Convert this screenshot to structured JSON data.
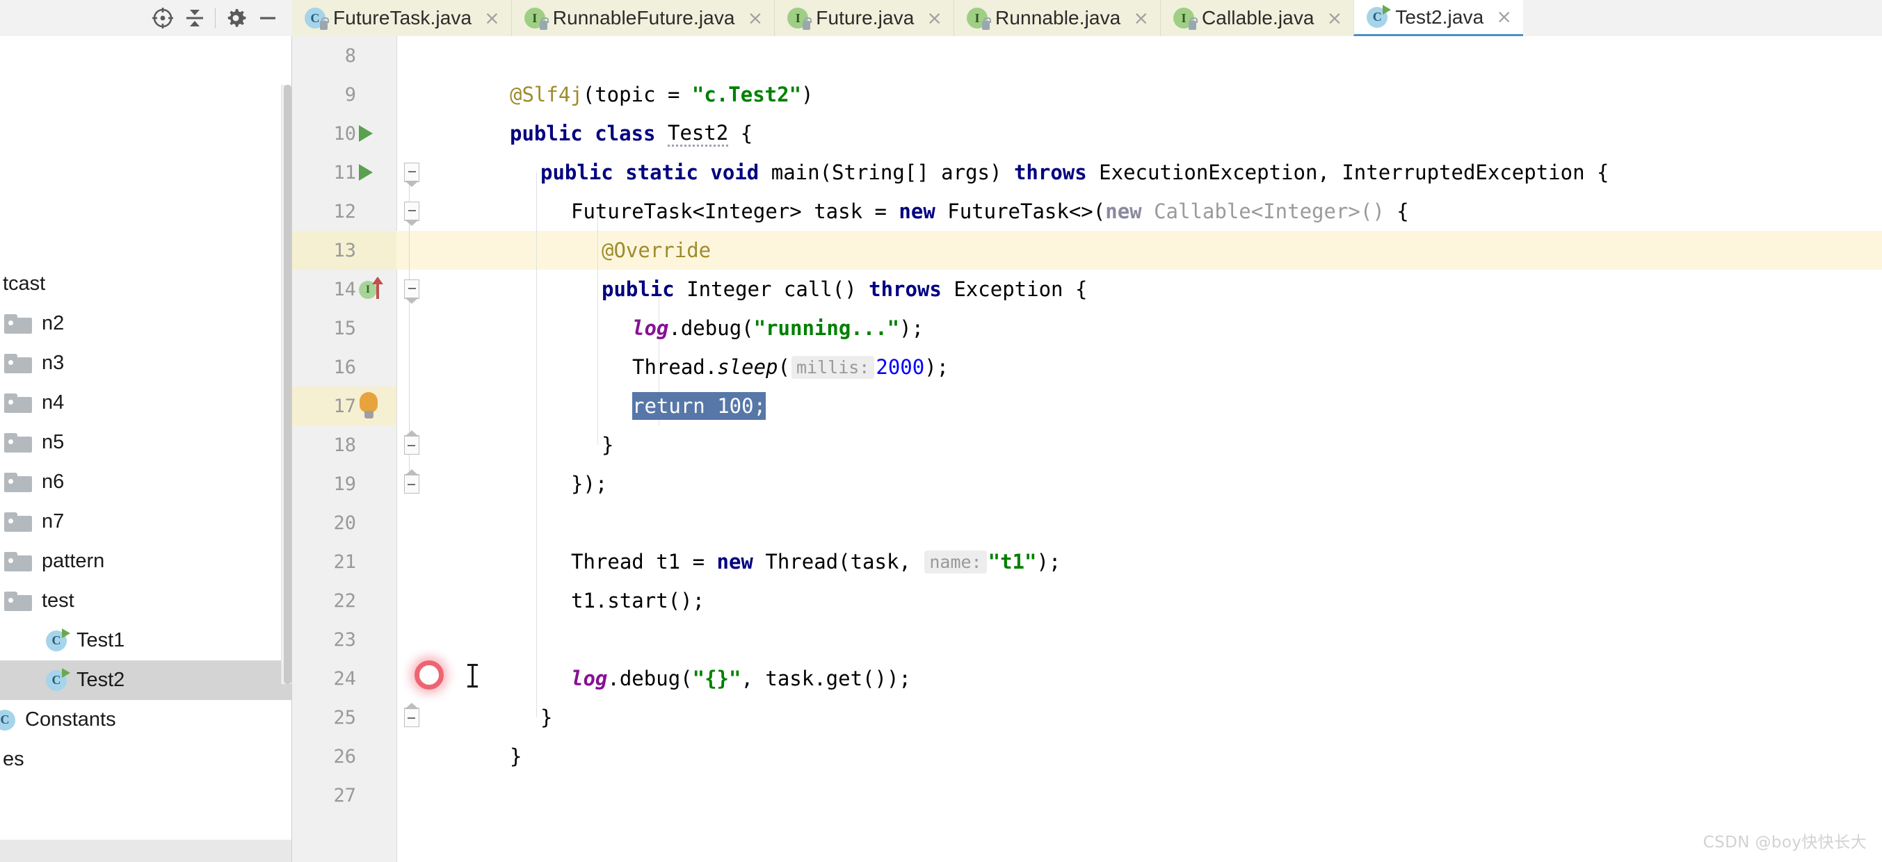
{
  "toolbar": {
    "icons": [
      {
        "name": "locate-target-icon",
        "glyph": "crosshair"
      },
      {
        "name": "collapse-all-icon",
        "glyph": "collapse"
      },
      {
        "name": "settings-gear-icon",
        "glyph": "gear"
      },
      {
        "name": "hide-panel-icon",
        "glyph": "minus"
      }
    ]
  },
  "tabs": [
    {
      "label": "FutureTask.java",
      "icon": "class-icon",
      "kind": "cls",
      "active": false,
      "close": "×"
    },
    {
      "label": "RunnableFuture.java",
      "icon": "interface-icon",
      "kind": "iface",
      "active": false,
      "close": "×"
    },
    {
      "label": "Future.java",
      "icon": "interface-icon",
      "kind": "iface",
      "active": false,
      "close": "×"
    },
    {
      "label": "Runnable.java",
      "icon": "interface-icon",
      "kind": "iface",
      "active": false,
      "close": "×"
    },
    {
      "label": "Callable.java",
      "icon": "interface-icon",
      "kind": "iface",
      "active": false,
      "close": "×"
    },
    {
      "label": "Test2.java",
      "icon": "runnable-class-icon",
      "kind": "cls-run",
      "active": true,
      "close": "×"
    }
  ],
  "tab_icon_letters": {
    "cls": "C",
    "iface": "I",
    "cls-run": "C"
  },
  "sidebar": {
    "tree": [
      {
        "label": "tcast",
        "type": "folder-cut",
        "indent": 0,
        "selected": false
      },
      {
        "label": "n2",
        "type": "folder",
        "indent": 1,
        "selected": false
      },
      {
        "label": "n3",
        "type": "folder",
        "indent": 1,
        "selected": false
      },
      {
        "label": "n4",
        "type": "folder",
        "indent": 1,
        "selected": false
      },
      {
        "label": "n5",
        "type": "folder",
        "indent": 1,
        "selected": false
      },
      {
        "label": "n6",
        "type": "folder",
        "indent": 1,
        "selected": false
      },
      {
        "label": "n7",
        "type": "folder",
        "indent": 1,
        "selected": false
      },
      {
        "label": "pattern",
        "type": "folder",
        "indent": 1,
        "selected": false
      },
      {
        "label": "test",
        "type": "folder",
        "indent": 1,
        "selected": false
      },
      {
        "label": "Test1",
        "type": "runnable-class",
        "indent": 2,
        "selected": false
      },
      {
        "label": "Test2",
        "type": "runnable-class",
        "indent": 2,
        "selected": true
      },
      {
        "label": "Constants",
        "type": "class",
        "indent": 0,
        "selected": false
      },
      {
        "label": "es",
        "type": "text",
        "indent": 0,
        "selected": false
      }
    ]
  },
  "editor": {
    "lines": [
      {
        "no": "8",
        "gutter": "",
        "fold": "",
        "current": false
      },
      {
        "no": "9",
        "gutter": "",
        "fold": "",
        "current": false
      },
      {
        "no": "10",
        "gutter": "run",
        "fold": "",
        "current": false
      },
      {
        "no": "11",
        "gutter": "run",
        "fold": "start",
        "current": false
      },
      {
        "no": "12",
        "gutter": "",
        "fold": "start",
        "current": false
      },
      {
        "no": "13",
        "gutter": "",
        "fold": "",
        "current": false
      },
      {
        "no": "14",
        "gutter": "implements",
        "fold": "start",
        "current": false
      },
      {
        "no": "15",
        "gutter": "",
        "fold": "",
        "current": false
      },
      {
        "no": "16",
        "gutter": "",
        "fold": "",
        "current": false
      },
      {
        "no": "17",
        "gutter": "bulb",
        "fold": "",
        "current": true
      },
      {
        "no": "18",
        "gutter": "",
        "fold": "end",
        "current": false
      },
      {
        "no": "19",
        "gutter": "",
        "fold": "end",
        "current": false
      },
      {
        "no": "20",
        "gutter": "",
        "fold": "",
        "current": false
      },
      {
        "no": "21",
        "gutter": "",
        "fold": "",
        "current": false
      },
      {
        "no": "22",
        "gutter": "",
        "fold": "",
        "current": false
      },
      {
        "no": "23",
        "gutter": "",
        "fold": "",
        "current": false
      },
      {
        "no": "24",
        "gutter": "",
        "fold": "",
        "current": false
      },
      {
        "no": "25",
        "gutter": "",
        "fold": "end",
        "current": false
      },
      {
        "no": "26",
        "gutter": "",
        "fold": "",
        "current": false
      },
      {
        "no": "27",
        "gutter": "",
        "fold": "",
        "current": false
      }
    ],
    "code_text": {
      "l9": "@Slf4j(topic = \"c.Test2\")",
      "l10": "public class Test2 {",
      "l11": "    public static void main(String[] args) throws ExecutionException, InterruptedException {",
      "l12": "        FutureTask<Integer> task = new FutureTask<>(new Callable<Integer>() {",
      "l13": "            @Override",
      "l14": "            public Integer call() throws Exception {",
      "l15": "                log.debug(\"running...\");",
      "l16": "                Thread.sleep( millis: 2000);",
      "l17": "                return 100;",
      "l18": "            }",
      "l19": "        });",
      "l21": "        Thread t1 = new Thread(task,  name: \"t1\");",
      "l22": "        t1.start();",
      "l24": "        log.debug(\"{}\", task.get());",
      "l25": "    }",
      "l26": "}"
    },
    "inlay_hints": {
      "millis": "millis:",
      "name": "name:"
    },
    "selection_text": "return 100;",
    "colors": {
      "keyword": "#000080",
      "string": "#008000",
      "number": "#0000ff",
      "annotation": "#9e8c2e",
      "static_field": "#871094",
      "dimmed": "#9a9a9a",
      "selection_bg": "#5777a8",
      "current_line_bg": "#fdf6dd",
      "gutter_bg": "#f0f0f0",
      "active_tab_underline": "#4a90c4"
    }
  },
  "watermark": "CSDN @boy快快长大"
}
